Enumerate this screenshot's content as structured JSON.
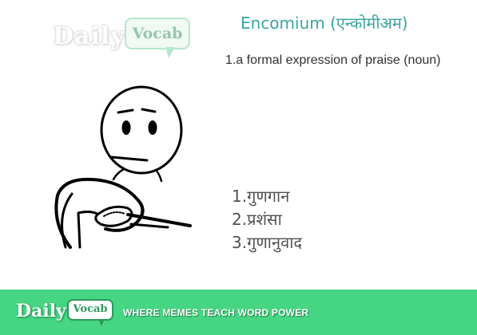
{
  "logo": {
    "daily": "Daily",
    "vocab": "Vocab"
  },
  "word": {
    "title": "Encomium (एन्कोमीअम)",
    "definition": "1.a formal expression of praise (noun)"
  },
  "meanings": [
    "1.गुणगान",
    "2.प्रशंसा",
    "3.गुणानुवाद"
  ],
  "banner": {
    "daily": "Daily",
    "vocab": "Vocab",
    "tagline": "WHERE MEMES TEACH WORD POWER",
    "color": "#46d582"
  },
  "colors": {
    "title": "#3ba5a1",
    "definition": "#303030",
    "meanings": "#505050"
  }
}
